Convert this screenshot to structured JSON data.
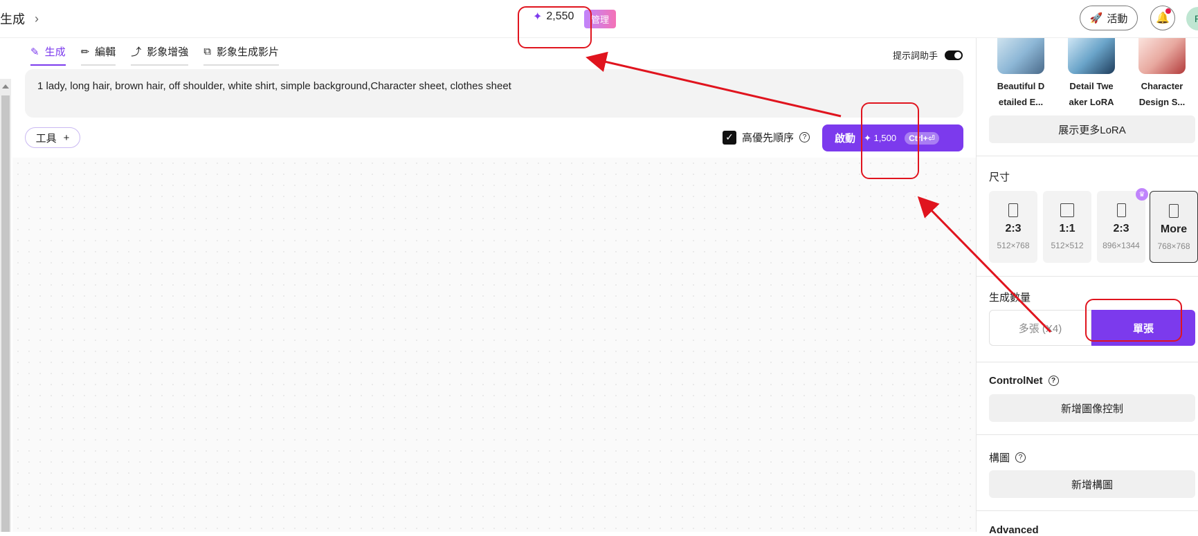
{
  "header": {
    "breadcrumb": "生成",
    "credits": "2,550",
    "manage_label": "管理",
    "activity_label": "活動",
    "avatar_letter": "R"
  },
  "tabs": [
    {
      "label": "生成",
      "icon": "pen-icon",
      "active": true
    },
    {
      "label": "編輯",
      "icon": "pencil-icon",
      "active": false
    },
    {
      "label": "影象增強",
      "icon": "enhance-icon",
      "active": false
    },
    {
      "label": "影象生成影片",
      "icon": "image-to-video-icon",
      "active": false
    }
  ],
  "helper_label": "提示詞助手",
  "prompt_text": "1 lady,  long hair, brown hair, off shoulder, white shirt, simple background,Character sheet, clothes sheet",
  "tools_label": "工具",
  "priority_label": "高優先順序",
  "start_button": {
    "label": "啟動",
    "cost": "1,500",
    "shortcut": "Ctrl+⏎"
  },
  "right_panel": {
    "loras": [
      {
        "name_line1": "Beautiful D",
        "name_line2": "etailed E...",
        "colors": [
          "#8db7d6",
          "#4a6a8a"
        ]
      },
      {
        "name_line1": "Detail Twe",
        "name_line2": "aker LoRA",
        "colors": [
          "#6aa4c9",
          "#1f3d5c"
        ]
      },
      {
        "name_line1": "Character",
        "name_line2": "Design S...",
        "colors": [
          "#e8a9a0",
          "#b23a3a"
        ]
      }
    ],
    "more_lora_label": "展示更多LoRA",
    "size_title": "尺寸",
    "sizes": [
      {
        "ratio": "2:3",
        "px": "512×768",
        "selected": false,
        "premium": false
      },
      {
        "ratio": "1:1",
        "px": "512×512",
        "selected": false,
        "premium": false
      },
      {
        "ratio": "2:3",
        "px": "896×1344",
        "selected": false,
        "premium": true
      },
      {
        "ratio": "More",
        "px": "768×768",
        "selected": true,
        "premium": false
      }
    ],
    "quantity_title": "生成數量",
    "quantity_multi": "多張 (X4)",
    "quantity_single": "單張",
    "controlnet_title": "ControlNet",
    "controlnet_button": "新增圖像控制",
    "composition_title": "構圖",
    "composition_button": "新增構圖",
    "advanced_title": "Advanced"
  },
  "colors": {
    "accent": "#7c3aed",
    "annotation": "#e0141e"
  }
}
